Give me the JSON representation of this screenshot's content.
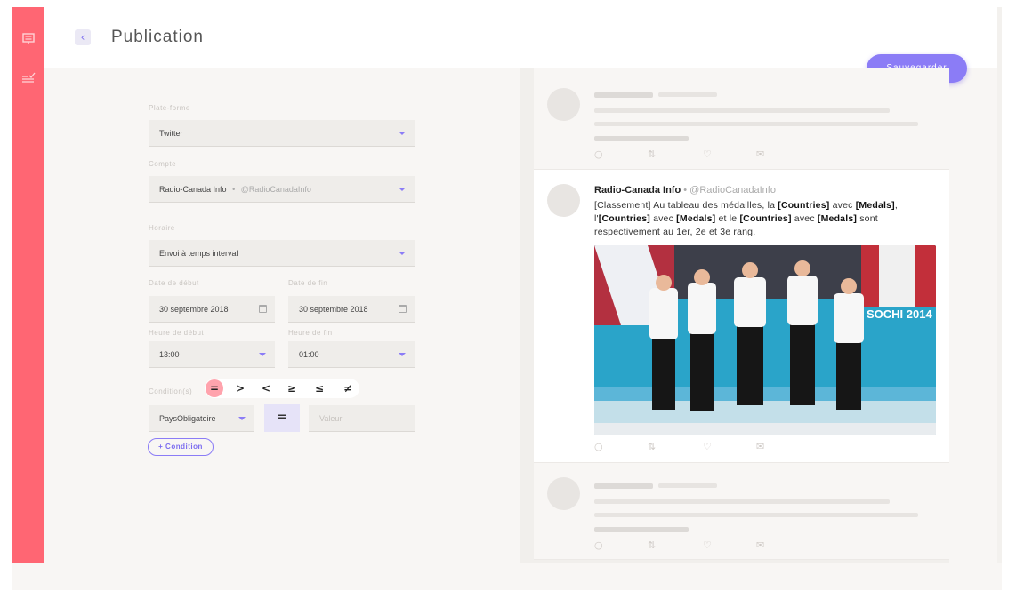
{
  "header": {
    "title": "Publication",
    "back_icon": "chevron-left-icon",
    "save_label": "Sauvegarder"
  },
  "sidebar": {
    "items": [
      {
        "icon": "presentation-icon"
      },
      {
        "icon": "checklist-icon"
      }
    ]
  },
  "colors": {
    "sidebar": "#ff6673",
    "accent": "#8b7cf6",
    "operator_active": "#ffa3ad"
  },
  "form": {
    "platform": {
      "label": "Plate-forme",
      "value": "Twitter"
    },
    "account": {
      "label": "Compte",
      "name": "Radio-Canada Info",
      "separator": "•",
      "handle": "@RadioCanadaInfo"
    },
    "schedule": {
      "label": "Horaire",
      "value": "Envoi à temps interval"
    },
    "start_date": {
      "label": "Date de début",
      "value": "30 septembre 2018"
    },
    "end_date": {
      "label": "Date de fin",
      "value": "30 septembre 2018"
    },
    "start_time": {
      "label": "Heure de début",
      "value": "13:00"
    },
    "end_time": {
      "label": "Heure de fin",
      "value": "01:00"
    },
    "conditions": {
      "label": "Condition(s)",
      "operators": [
        "=",
        ">",
        "<",
        "≥",
        "≤",
        "≠"
      ],
      "field": "PaysObligatoire",
      "operator": "=",
      "value_placeholder": "Valeur",
      "add_label": "+ Condition"
    }
  },
  "preview": {
    "tweet": {
      "author": "Radio-Canada Info",
      "separator": "•",
      "handle": "@RadioCanadaInfo",
      "t1": "[Classement] Au tableau des médailles, la ",
      "b1": "[Countries]",
      "t2": " avec ",
      "b2": "[Medals]",
      "t3": ", l'",
      "b3": "[Countries]",
      "t4": " avec ",
      "b4": "[Medals]",
      "t5": " et le ",
      "b5": "[Countries]",
      "t6": " avec ",
      "b6": "[Medals]",
      "t7": " sont respectivement au 1er, 2e et 3e rang.",
      "image_text": "SOCHI 2014"
    },
    "actions": [
      "reply-icon",
      "retweet-icon",
      "like-icon",
      "share-icon"
    ]
  }
}
